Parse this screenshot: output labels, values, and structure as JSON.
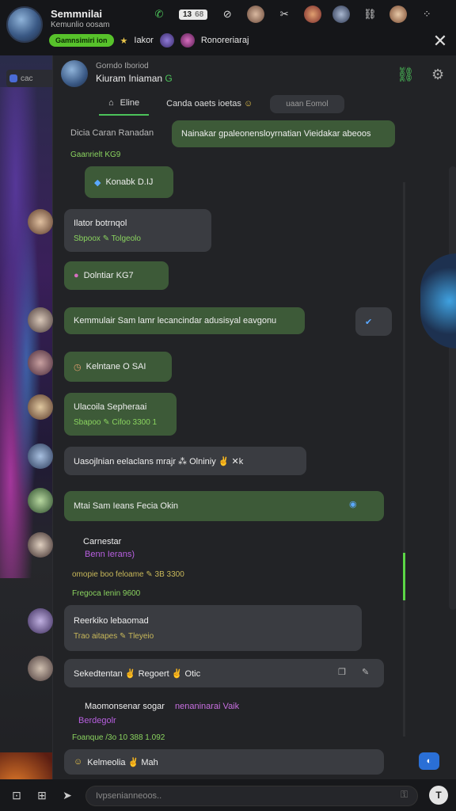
{
  "top": {
    "name": "Semmnilai",
    "sub": "Kemunlio oosam",
    "counter_main": "13",
    "counter_sub": "68",
    "server_tag": "Gamnsimiri ion",
    "server_text_1": "Iakor",
    "server_text_2": "Ronoreriaraj"
  },
  "left": {
    "badge": "cac"
  },
  "channel": {
    "top_label": "Gorndo Iboriod",
    "title": "Kiuram Iniaman",
    "title_mark": "G"
  },
  "tabs": {
    "home": "Eline",
    "second": "Canda oaets ioetas",
    "pill": "uaan Eomol"
  },
  "messages": [
    {
      "text": "Dicia Caran Ranadan"
    },
    {
      "text": "Nainakar gpaleonensloyrnatian Vieidakar abeoos"
    },
    {
      "text": "Gaanrielt KG9"
    },
    {
      "text": "Konabk D.IJ"
    },
    {
      "text": "Ilator botrnqol"
    },
    {
      "text": "Sbpoox ✎ Tolgeolo"
    },
    {
      "text": "Dolntiar KG7"
    },
    {
      "text": "Kemmulair Sam lamr lecancindar adusisyal eavgonu"
    },
    {
      "text": "Kelntane O SAI"
    },
    {
      "text": "Ulacoila Sepheraai"
    },
    {
      "text": "Sbapoo ✎ Cifoo 3300 1"
    },
    {
      "text": "Uasojlnian eelaclans mrajr ⁂ Olniniy ✌ ✕k"
    },
    {
      "text": "Mtai Sam Ieans Fecia Okin"
    },
    {
      "text": "Carnestar"
    },
    {
      "text": "Benn Ierans)"
    },
    {
      "text": "omopie boo feloame ✎ 3B 3300"
    },
    {
      "text": "Fregoca Ienin 9600"
    },
    {
      "text": "Reerkiko lebaomad"
    },
    {
      "text": "Trao aitapes ✎ Tleyeio"
    },
    {
      "text": "Sekedtentan ✌ Regoert ✌ Otic"
    },
    {
      "text": "Maomonsenar sogar"
    },
    {
      "text": "nenaninarai Vaik"
    },
    {
      "text": "Berdegolr"
    },
    {
      "text": "Foanque /3o 10 388 1.092"
    },
    {
      "text": "Kelmeolia ✌ Mah"
    }
  ],
  "bottom": {
    "placeholder": "Ivpsenianneoos.."
  },
  "colors": {
    "accent": "#4cc35a",
    "bubble_green": "#3d5a38",
    "bubble_gray": "#3a3c41",
    "bg": "#222326"
  }
}
